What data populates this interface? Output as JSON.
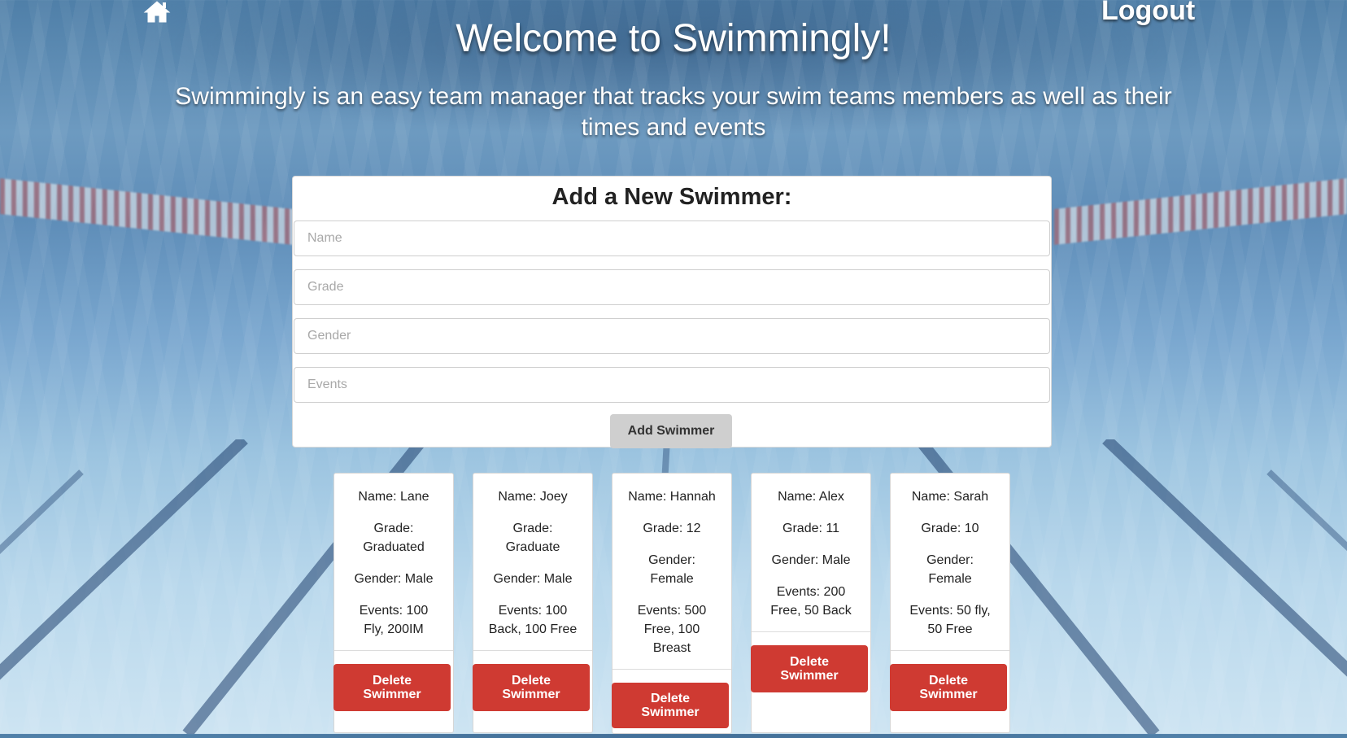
{
  "nav": {
    "home_icon": "home-icon",
    "logout_label": "Logout"
  },
  "hero": {
    "title": "Welcome to Swimmingly!",
    "subtitle": "Swimmingly is an easy team manager that tracks your swim teams members as well as their times and events"
  },
  "form": {
    "title": "Add a New Swimmer:",
    "name_placeholder": "Name",
    "grade_placeholder": "Grade",
    "gender_placeholder": "Gender",
    "events_placeholder": "Events",
    "submit_label": "Add Swimmer"
  },
  "swimmers": [
    {
      "name": "Name: Lane",
      "grade": "Grade: Graduated",
      "gender": "Gender: Male",
      "events": "Events: 100 Fly, 200IM",
      "delete_label": "Delete Swimmer"
    },
    {
      "name": "Name: Joey",
      "grade": "Grade: Graduate",
      "gender": "Gender: Male",
      "events": "Events: 100 Back, 100 Free",
      "delete_label": "Delete Swimmer"
    },
    {
      "name": "Name: Hannah",
      "grade": "Grade: 12",
      "gender": "Gender: Female",
      "events": "Events: 500 Free, 100 Breast",
      "delete_label": "Delete Swimmer"
    },
    {
      "name": "Name: Alex",
      "grade": "Grade: 11",
      "gender": "Gender: Male",
      "events": "Events: 200 Free, 50 Back",
      "delete_label": "Delete Swimmer"
    },
    {
      "name": "Name: Sarah",
      "grade": "Grade: 10",
      "gender": "Gender: Female",
      "events": "Events: 50 fly, 50 Free",
      "delete_label": "Delete Swimmer"
    }
  ],
  "colors": {
    "delete": "#cf3a32",
    "add_button": "#cfcfcf"
  }
}
